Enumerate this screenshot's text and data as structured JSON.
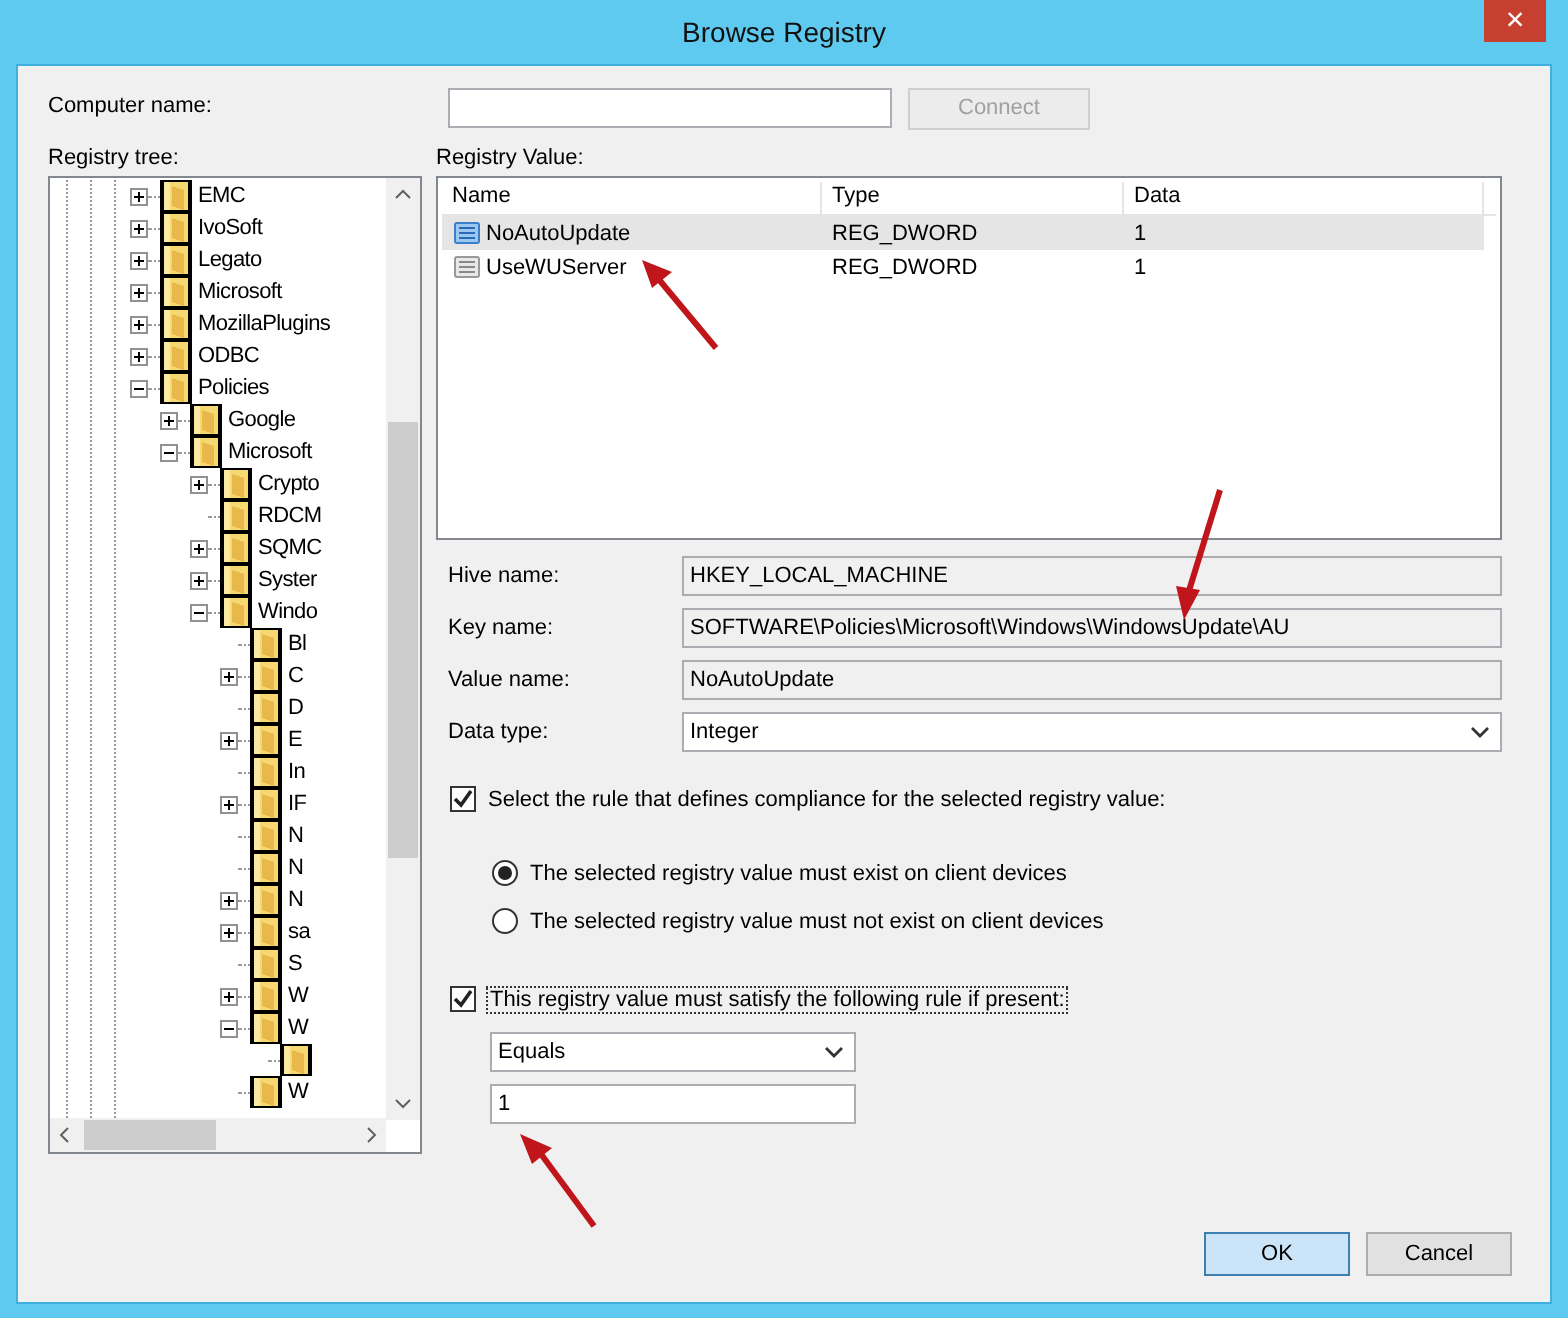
{
  "window": {
    "title": "Browse Registry",
    "close": "×"
  },
  "computer": {
    "label": "Computer name:",
    "connect": "Connect",
    "connect_disabled": true
  },
  "tree": {
    "label": "Registry tree:",
    "items": [
      {
        "label": "EMC",
        "kind": "collapsed"
      },
      {
        "label": "IvoSoft",
        "kind": "collapsed"
      },
      {
        "label": "Legato",
        "kind": "collapsed"
      },
      {
        "label": "Microsoft",
        "kind": "collapsed"
      },
      {
        "label": "MozillaPlugins",
        "kind": "collapsed"
      },
      {
        "label": "ODBC",
        "kind": "collapsed"
      },
      {
        "label": "Policies",
        "kind": "expanded",
        "children": [
          {
            "label": "Google",
            "kind": "collapsed"
          },
          {
            "label": "Microsoft",
            "kind": "expanded",
            "children": [
              {
                "label": "Crypto",
                "kind": "collapsed"
              },
              {
                "label": "RDCM",
                "kind": "leaf"
              },
              {
                "label": "SQMC",
                "kind": "collapsed"
              },
              {
                "label": "Syster",
                "kind": "collapsed"
              },
              {
                "label": "Windo",
                "kind": "expanded",
                "children": [
                  {
                    "label": "Bl",
                    "kind": "leaf"
                  },
                  {
                    "label": "C",
                    "kind": "collapsed"
                  },
                  {
                    "label": "D",
                    "kind": "leaf"
                  },
                  {
                    "label": "E",
                    "kind": "collapsed"
                  },
                  {
                    "label": "In",
                    "kind": "leaf"
                  },
                  {
                    "label": "IF",
                    "kind": "collapsed"
                  },
                  {
                    "label": "N",
                    "kind": "leaf"
                  },
                  {
                    "label": "N",
                    "kind": "leaf"
                  },
                  {
                    "label": "N",
                    "kind": "collapsed"
                  },
                  {
                    "label": "sa",
                    "kind": "collapsed"
                  },
                  {
                    "label": "S",
                    "kind": "leaf"
                  },
                  {
                    "label": "W",
                    "kind": "collapsed"
                  },
                  {
                    "label": "W",
                    "kind": "expanded",
                    "children": [
                      {
                        "kind": "leaf"
                      }
                    ]
                  },
                  {
                    "label": "W",
                    "kind": "leaf"
                  }
                ]
              }
            ]
          }
        ]
      }
    ]
  },
  "values": {
    "label": "Registry Value:",
    "columns": [
      "Name",
      "Type",
      "Data"
    ],
    "rows": [
      {
        "name": "NoAutoUpdate",
        "type": "REG_DWORD",
        "data": "1",
        "selected": true
      },
      {
        "name": "UseWUServer",
        "type": "REG_DWORD",
        "data": "1",
        "selected": false
      }
    ]
  },
  "details": [
    {
      "label": "Hive name:",
      "value": "HKEY_LOCAL_MACHINE",
      "kind": "readonly"
    },
    {
      "label": "Key name:",
      "value": "SOFTWARE\\Policies\\Microsoft\\Windows\\WindowsUpdate\\AU",
      "kind": "readonly"
    },
    {
      "label": "Value name:",
      "value": "NoAutoUpdate",
      "kind": "readonly"
    },
    {
      "label": "Data type:",
      "value": "Integer",
      "kind": "dropdown"
    }
  ],
  "compliance": {
    "label": "Select the rule that defines compliance for the selected registry value:",
    "checked": true,
    "options": [
      {
        "label": "The selected registry value must exist on client devices",
        "selected": true
      },
      {
        "label": "The selected registry value must not exist on client devices",
        "selected": false
      }
    ]
  },
  "rule": {
    "label": "This registry value must satisfy the following rule if present:",
    "checked": true,
    "operator": "Equals",
    "value": "1"
  },
  "buttons": [
    {
      "label": "OK",
      "default": true
    },
    {
      "label": "Cancel",
      "default": false
    }
  ]
}
